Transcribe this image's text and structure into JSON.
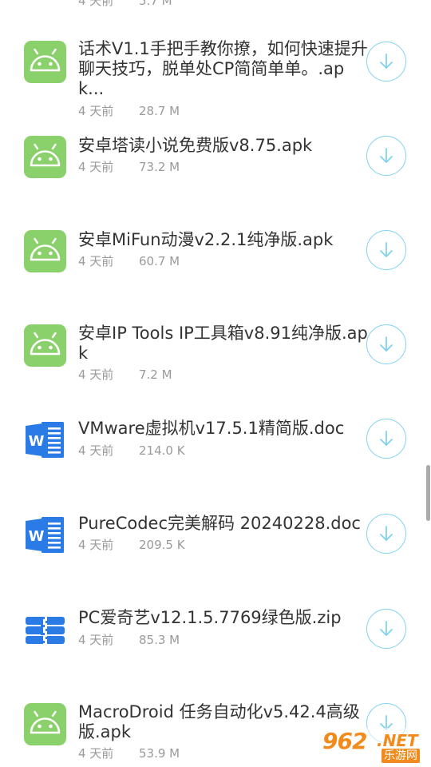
{
  "colors": {
    "android_icon": "#8bd16b",
    "word_icon": "#2b7be6",
    "archive_icon": "#2b7be6",
    "download_ring": "#7fd3f1",
    "title_text": "#333333",
    "meta_text": "#9a9a9a",
    "watermark": "#f28a1c"
  },
  "top_partial": {
    "date": "4 天前",
    "size": "5.7 M"
  },
  "files": [
    {
      "title": "话术V1.1手把手教你撩，如何快速提升聊天技巧，脱单处CP简简单单。.apk...",
      "date": "4 天前",
      "size": "28.7 M",
      "icon": "android-icon"
    },
    {
      "title": "安卓塔读小说免费版v8.75.apk",
      "date": "4 天前",
      "size": "73.2 M",
      "icon": "android-icon"
    },
    {
      "title": "安卓MiFun动漫v2.2.1纯净版.apk",
      "date": "4 天前",
      "size": "60.7 M",
      "icon": "android-icon"
    },
    {
      "title": "安卓IP Tools IP工具箱v8.91纯净版.apk",
      "date": "4 天前",
      "size": "7.2 M",
      "icon": "android-icon"
    },
    {
      "title": "VMware虚拟机v17.5.1精简版.doc",
      "date": "4 天前",
      "size": "214.0 K",
      "icon": "word-doc-icon"
    },
    {
      "title": "PureCodec完美解码 20240228.doc",
      "date": "4 天前",
      "size": "209.5 K",
      "icon": "word-doc-icon"
    },
    {
      "title": "PC爱奇艺v12.1.5.7769绿色版.zip",
      "date": "4 天前",
      "size": "85.3 M",
      "icon": "archive-icon"
    },
    {
      "title": "MacroDroid 任务自动化v5.42.4高级版.apk",
      "date": "4 天前",
      "size": "53.9 M",
      "icon": "android-icon"
    }
  ],
  "watermark": {
    "number": "962",
    "domain": ".NET",
    "site": "乐游网"
  }
}
